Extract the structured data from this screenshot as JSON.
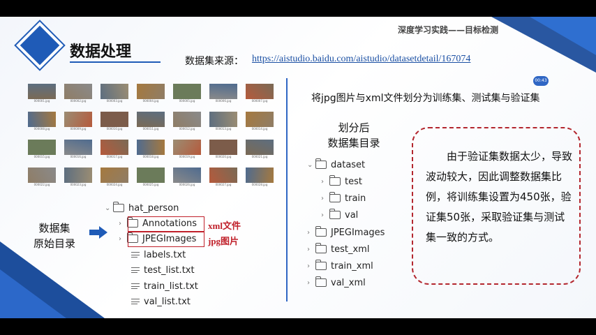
{
  "header": {
    "title": "数据处理",
    "course": "深度学习实践——目标检测",
    "source_label": "数据集来源：",
    "source_link": "https://aistudio.baidu.com/aistudio/datasetdetail/167074",
    "timer": "00:43"
  },
  "thumbnails": {
    "captions": [
      "000001.jpg",
      "000002.jpg",
      "000003.jpg",
      "000004.jpg",
      "000005.jpg",
      "000006.jpg",
      "000007.jpg",
      "000008.jpg",
      "000009.jpg",
      "000010.jpg",
      "000011.jpg",
      "000012.jpg",
      "000013.jpg",
      "000014.jpg",
      "000015.jpg",
      "000016.jpg",
      "000017.jpg",
      "000018.jpg",
      "000019.jpg",
      "000020.jpg",
      "000021.jpg",
      "000022.jpg",
      "000023.jpg",
      "000024.jpg",
      "000025.jpg",
      "000026.jpg",
      "000027.jpg",
      "000028.jpg"
    ]
  },
  "original": {
    "label_line1": "数据集",
    "label_line2": "原始目录",
    "root": "hat_person",
    "annotations": "Annotations",
    "jpegimages": "JPEGImages",
    "labels": "labels.txt",
    "test_list": "test_list.txt",
    "train_list": "train_list.txt",
    "val_list": "val_list.txt",
    "xml_note": "xml文件",
    "jpg_note": "jpg图片"
  },
  "split": {
    "description": "将jpg图片与xml文件划分为训练集、测试集与验证集",
    "label_line1": "划分后",
    "label_line2": "数据集目录",
    "dataset": "dataset",
    "test": "test",
    "train": "train",
    "val": "val",
    "jpegimages": "JPEGImages",
    "test_xml": "test_xml",
    "train_xml": "train_xml",
    "val_xml": "val_xml"
  },
  "note": {
    "text": "　　由于验证集数据太少，导致波动较大，因此调整数据集比例，将训练集设置为450张，验证集50张，采取验证集与测试集一致的方式。"
  },
  "colors": {
    "accent": "#1f5bb7",
    "highlight": "#c0202a"
  }
}
